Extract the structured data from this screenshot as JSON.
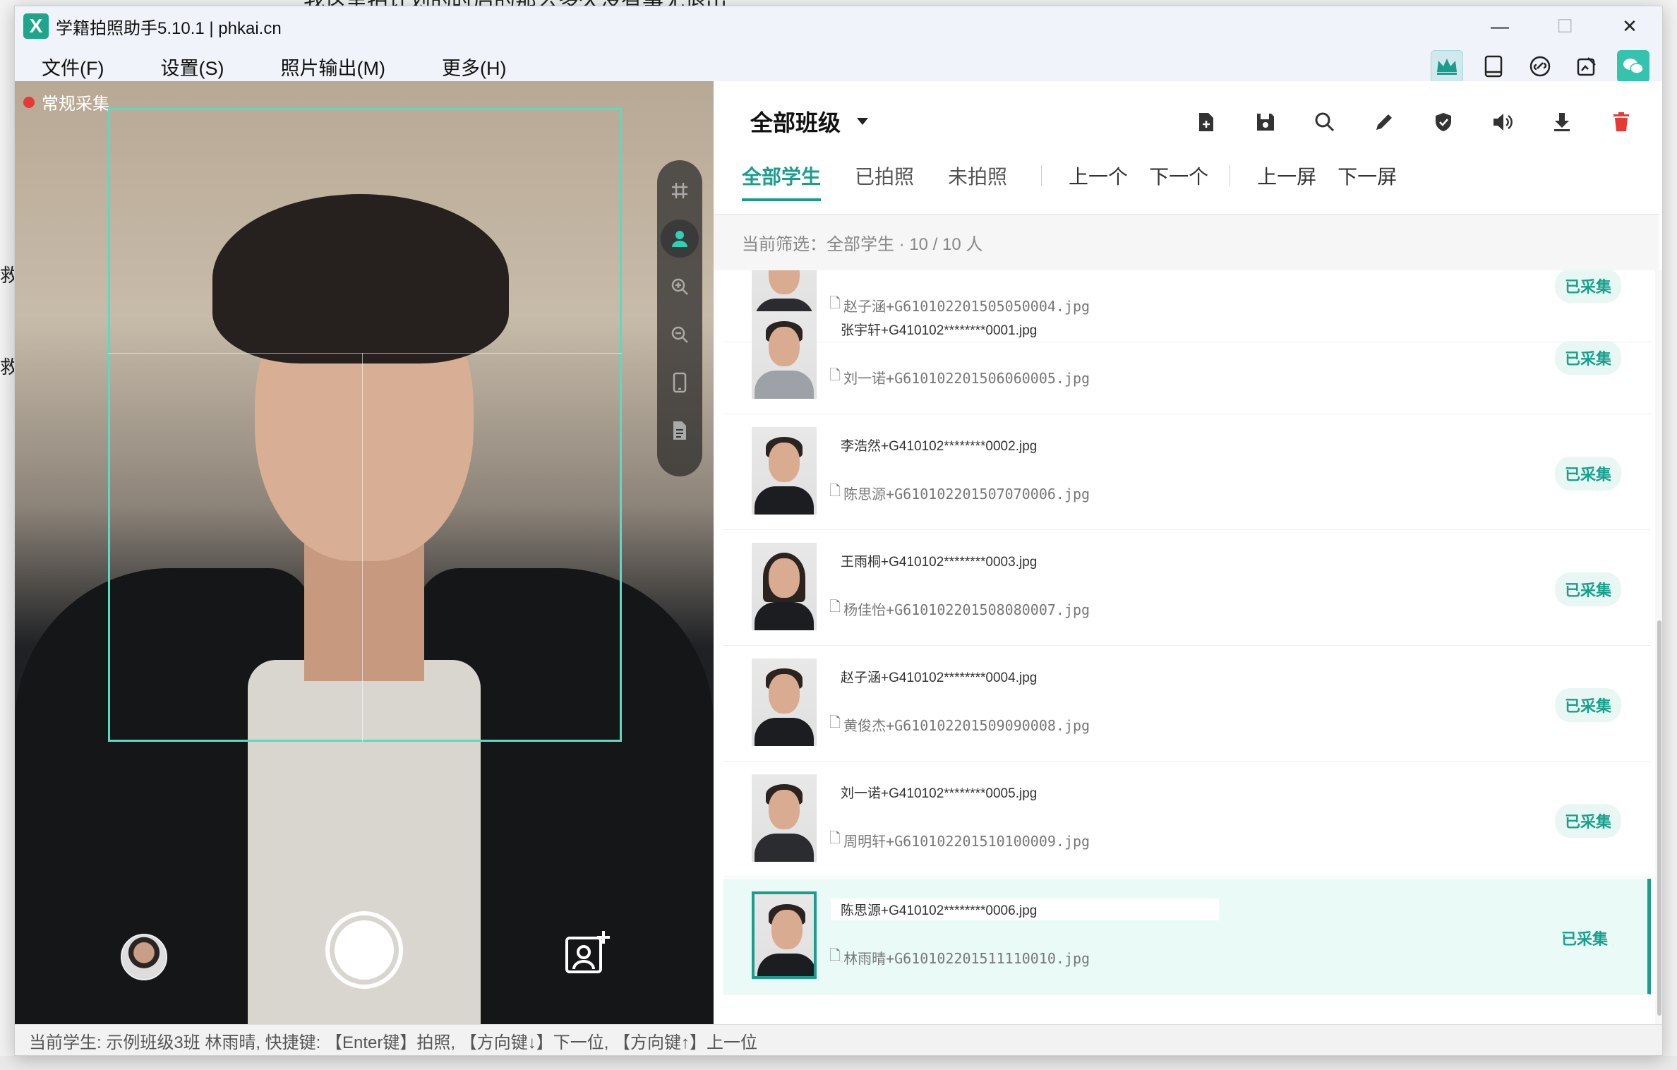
{
  "window": {
    "title": "学籍拍照助手5.10.1 | phkai.cn",
    "logo_letter": "X"
  },
  "window_controls": {
    "minimize": "—",
    "maximize": "☐",
    "close": "✕"
  },
  "menu": [
    "文件(F)",
    "设置(S)",
    "照片输出(M)",
    "更多(H)"
  ],
  "menu_icons": [
    "crown-icon",
    "tablet-icon",
    "link-icon",
    "edit-image-icon",
    "wechat-icon"
  ],
  "camera": {
    "mode_label": "常规采集"
  },
  "header": {
    "class_selector": "全部班级"
  },
  "tabs": {
    "all": "全部学生",
    "taken": "已拍照",
    "not_taken": "未拍照"
  },
  "nav": {
    "prev": "上一个",
    "next": "下一个",
    "prev_screen": "上一屏",
    "next_screen": "下一屏"
  },
  "filter": {
    "text": "当前筛选：全部学生 · 10 / 10 人"
  },
  "students": [
    {
      "id": "",
      "file": "赵子涵+G610102201505050004.jpg",
      "status": "已采集"
    },
    {
      "id": "张宇轩+G410102********0001.jpg",
      "file": "刘一诺+G610102201506060005.jpg",
      "status": "已采集"
    },
    {
      "id": "李浩然+G410102********0002.jpg",
      "file": "陈思源+G610102201507070006.jpg",
      "status": "已采集"
    },
    {
      "id": "王雨桐+G410102********0003.jpg",
      "file": "杨佳怡+G610102201508080007.jpg",
      "status": "已采集"
    },
    {
      "id": "赵子涵+G410102********0004.jpg",
      "file": "黄俊杰+G610102201509090008.jpg",
      "status": "已采集"
    },
    {
      "id": "刘一诺+G410102********0005.jpg",
      "file": "周明轩+G610102201510100009.jpg",
      "status": "已采集"
    },
    {
      "id": "陈思源+G410102********0006.jpg",
      "file": "林雨晴+G610102201511110010.jpg",
      "status": "已采集"
    }
  ],
  "status_bar": "当前学生: 示例班级3班 林雨晴, 快捷键: 【Enter键】拍照, 【方向键↓】下一位, 【方向键↑】上一位",
  "colors": {
    "accent": "#1a9d8d",
    "guide": "#5fd8c2",
    "delete": "#e53935"
  }
}
